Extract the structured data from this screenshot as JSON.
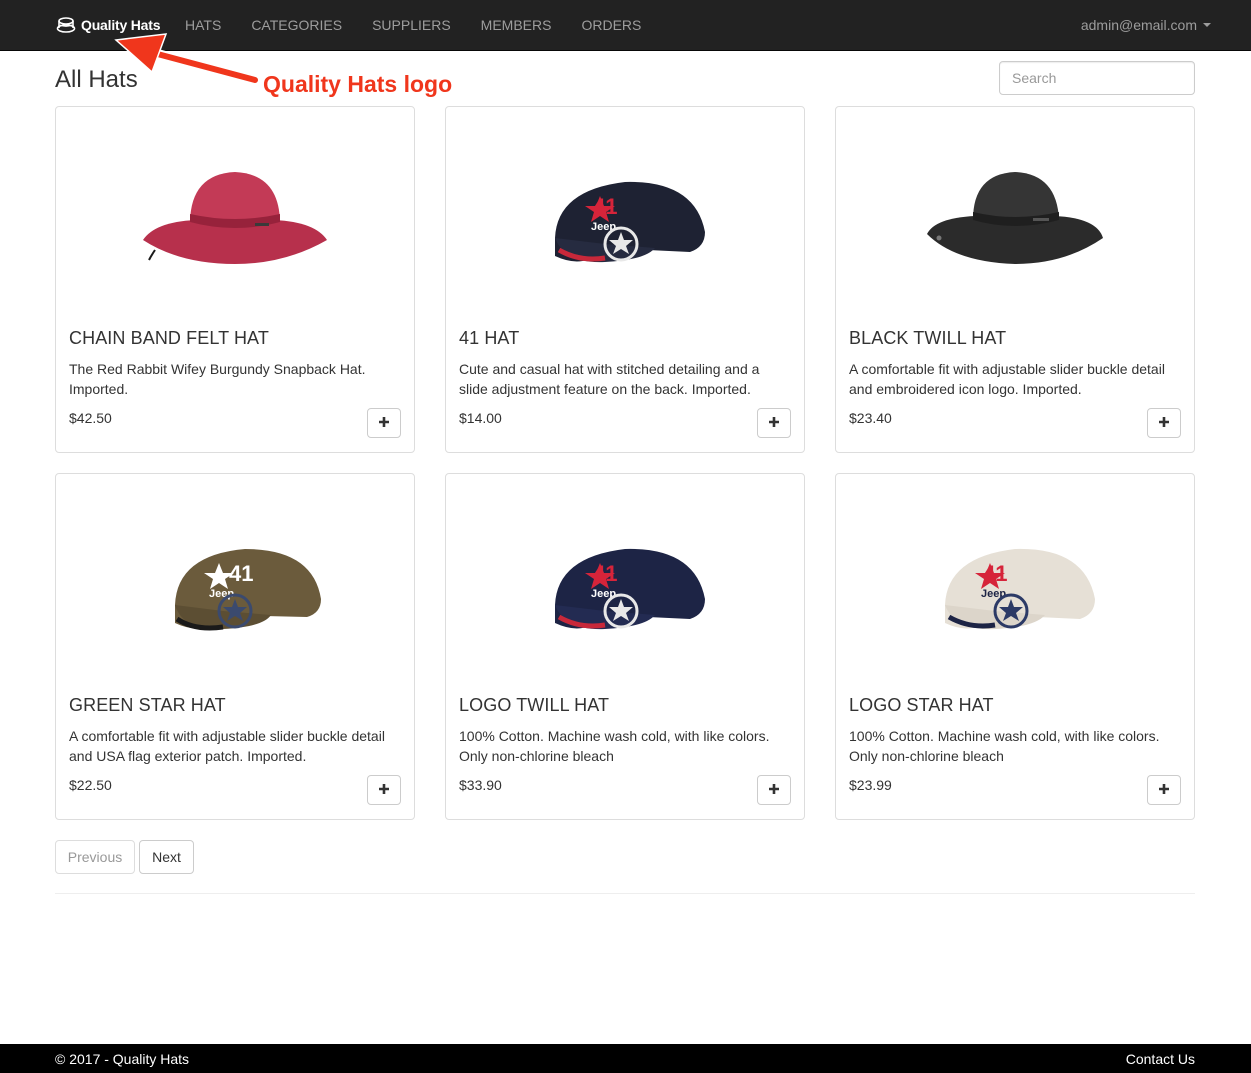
{
  "navbar": {
    "brand": "Quality Hats",
    "brand_icon": "hat-icon",
    "links": [
      "HATS",
      "CATEGORIES",
      "SUPPLIERS",
      "MEMBERS",
      "ORDERS"
    ],
    "user": "admin@email.com"
  },
  "annotation": {
    "label": "Quality Hats logo",
    "color": "#f0361c"
  },
  "page": {
    "title": "All Hats"
  },
  "search": {
    "placeholder": "Search",
    "value": ""
  },
  "products": [
    {
      "name": "CHAIN BAND FELT HAT",
      "description": "The Red Rabbit Wifey Burgundy Snapback Hat. Imported.",
      "price": "$42.50",
      "image": "burgundy-bucket-hat",
      "color": "#b22e4b"
    },
    {
      "name": "41 HAT",
      "description": "Cute and casual hat with stitched detailing and a slide adjustment feature on the back. Imported.",
      "price": "$14.00",
      "image": "navy-baseball-cap",
      "color": "#1e2233"
    },
    {
      "name": "BLACK TWILL HAT",
      "description": "A comfortable fit with adjustable slider buckle detail and embroidered icon logo. Imported.",
      "price": "$23.40",
      "image": "black-bucket-hat",
      "color": "#2a2a2a"
    },
    {
      "name": "GREEN STAR HAT",
      "description": "A comfortable fit with adjustable slider buckle detail and USA flag exterior patch. Imported.",
      "price": "$22.50",
      "image": "olive-baseball-cap",
      "color": "#6e5e3e"
    },
    {
      "name": "LOGO TWILL HAT",
      "description": "100% Cotton. Machine wash cold, with like colors. Only non-chlorine bleach",
      "price": "$33.90",
      "image": "navy-baseball-cap",
      "color": "#1d2445"
    },
    {
      "name": "LOGO STAR HAT",
      "description": "100% Cotton. Machine wash cold, with like colors. Only non-chlorine bleach",
      "price": "$23.99",
      "image": "beige-baseball-cap",
      "color": "#e6e0d6"
    }
  ],
  "add_button_icon": "plus-icon",
  "pagination": {
    "previous": "Previous",
    "next": "Next"
  },
  "footer": {
    "copyright": "© 2017 - Quality Hats",
    "contact": "Contact Us"
  }
}
